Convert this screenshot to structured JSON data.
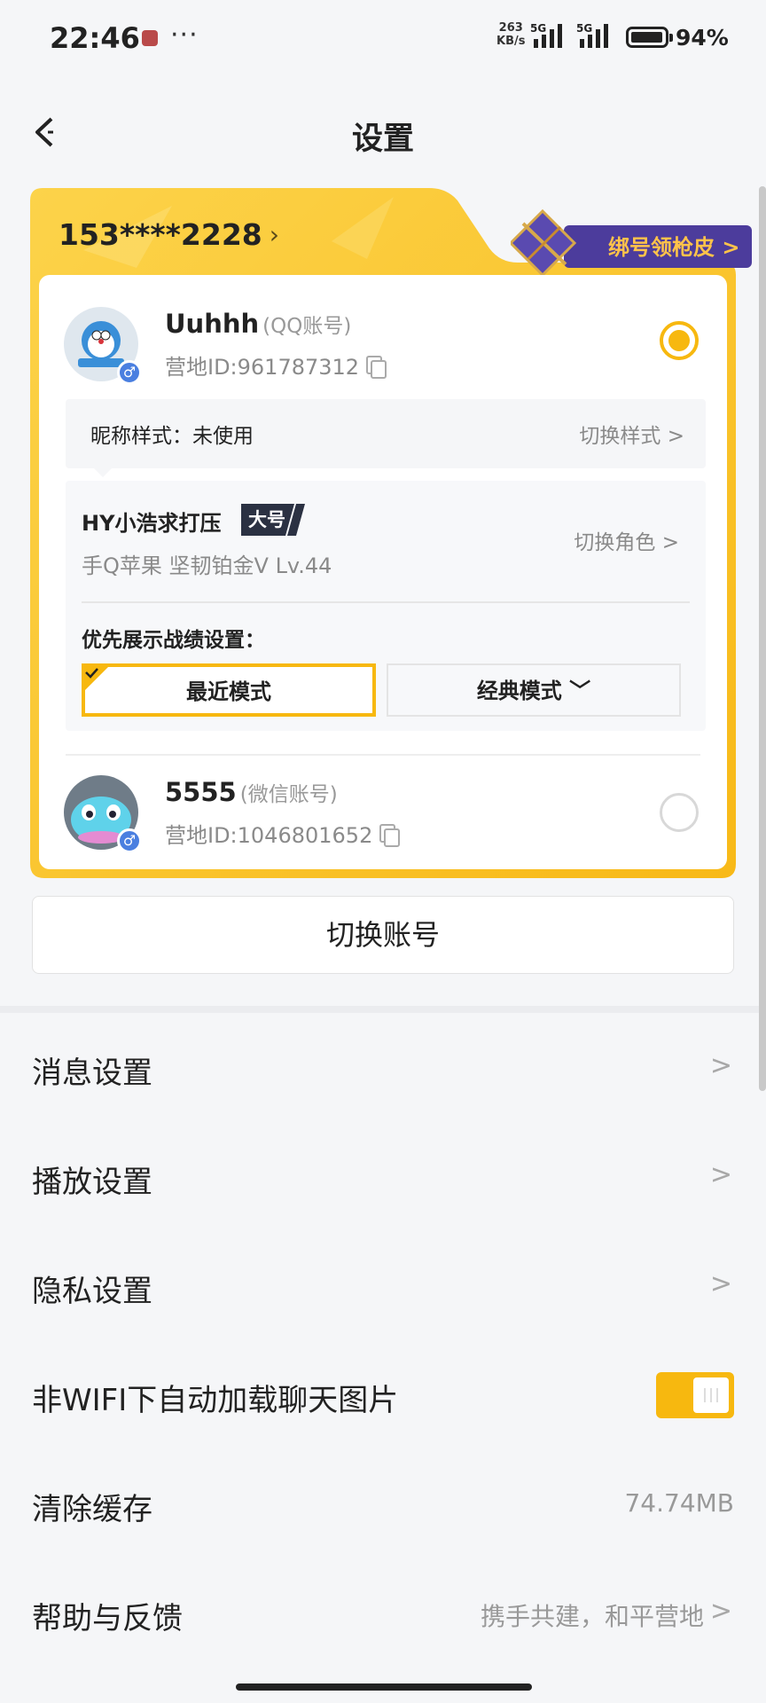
{
  "status_bar": {
    "time": "22:46",
    "dots": "···",
    "net_speed_value": "263",
    "net_speed_unit": "KB/s",
    "signal_label_1": "5G",
    "signal_label_2": "5G",
    "battery_pct": "94%"
  },
  "header": {
    "title": "设置",
    "back_icon": "back-arrow-icon"
  },
  "account_card": {
    "phone": "153****2228",
    "bind_label": "绑号领枪皮 >",
    "accounts": [
      {
        "name": "Uuhhh",
        "type_tag": "(QQ账号)",
        "camp_id": "营地ID:961787312",
        "gender": "♂",
        "selected": true
      },
      {
        "name": "5555",
        "type_tag": "(微信账号)",
        "camp_id": "营地ID:1046801652",
        "gender": "♂",
        "selected": false
      }
    ],
    "nickname_style_label": "昵称样式：未使用",
    "switch_style_label": "切换样式 >",
    "role": {
      "name": "HY小浩求打压",
      "tag": "大号",
      "info": "手Q苹果  坚韧铂金Ⅴ  Lv.44",
      "switch_role_label": "切换角色 >"
    },
    "priority_label": "优先展示战绩设置：",
    "modes": {
      "recent": "最近模式",
      "classic": "经典模式 ﹀"
    }
  },
  "switch_account_label": "切换账号",
  "settings_list": [
    {
      "label": "消息设置",
      "chevron": ">"
    },
    {
      "label": "播放设置",
      "chevron": ">"
    },
    {
      "label": "隐私设置",
      "chevron": ">"
    },
    {
      "label": "非WIFI下自动加载聊天图片",
      "toggle_on": true
    },
    {
      "label": "清除缓存",
      "value": "74.74MB"
    },
    {
      "label": "帮助与反馈",
      "value": "携手共建，和平营地",
      "chevron": ">"
    }
  ],
  "colors": {
    "accent": "#f7b80f",
    "card_gold": "#fbc226",
    "bind_bg": "#4c3c9c"
  }
}
